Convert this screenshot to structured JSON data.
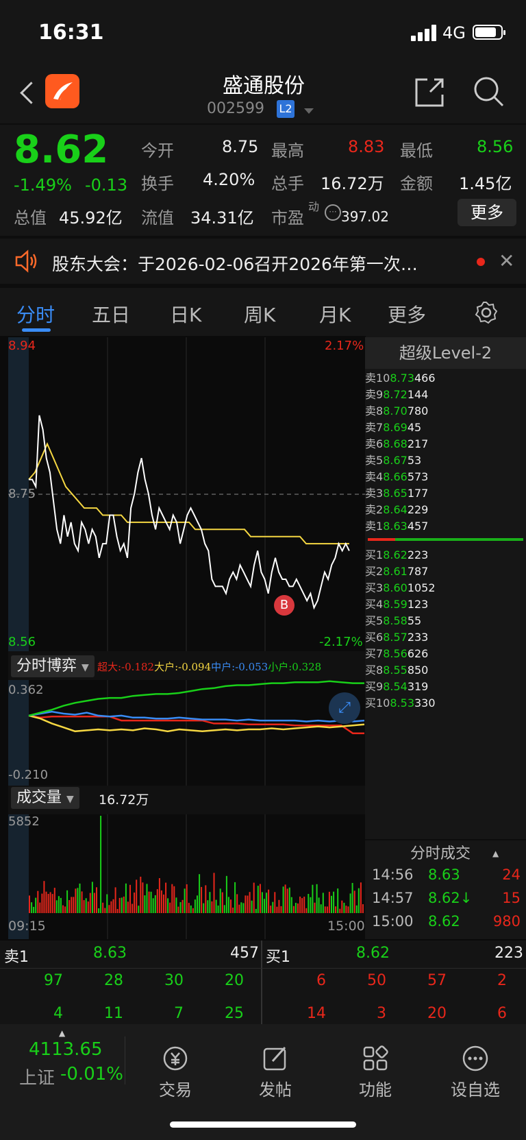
{
  "status_bar": {
    "time": "16:31",
    "network": "4G"
  },
  "header": {
    "title": "盛通股份",
    "code": "002599",
    "badge": "L2"
  },
  "quote": {
    "price": "8.62",
    "change_pct": "-1.49%",
    "change": "-0.13",
    "open_label": "今开",
    "open": "8.75",
    "high_label": "最高",
    "high": "8.83",
    "low_label": "最低",
    "low": "8.56",
    "turnover_label": "换手",
    "turnover": "4.20%",
    "volume_label": "总手",
    "volume": "16.72万",
    "amount_label": "金额",
    "amount": "1.45亿",
    "mcap_label": "总值",
    "mcap": "45.92亿",
    "float_label": "流值",
    "float_mcap": "34.31亿",
    "pe_label": "市盈",
    "pe_sup": "动",
    "pe": "397.02",
    "more_button": "更多"
  },
  "notice": {
    "text": "股东大会：于2026-02-06召开2026年第一次…"
  },
  "tabs": [
    "分时",
    "五日",
    "日K",
    "周K",
    "月K",
    "更多"
  ],
  "chart": {
    "y_max": "8.94",
    "y_max_pct": "2.17%",
    "y_min": "8.56",
    "y_min_pct": "-2.17%",
    "ref_price": "8.75",
    "buy_marker": "B",
    "game_label": "分时博弈",
    "game_legend": [
      {
        "label": "超大:-0.182",
        "color": "#e8271b"
      },
      {
        "label": "大户:-0.094",
        "color": "#f5d742"
      },
      {
        "label": "中户:-0.053",
        "color": "#3a8cf5"
      },
      {
        "label": "小户:0.328",
        "color": "#19d019"
      }
    ],
    "game_max": "0.362",
    "game_min": "-0.210",
    "vol_label": "成交量",
    "vol_total": "16.72万",
    "vol_max": "5852",
    "t_start": "09:15",
    "t_end": "15:00"
  },
  "chart_data": {
    "type": "line",
    "y_range": [
      8.56,
      8.94
    ],
    "price_series": [
      8.75,
      8.75,
      8.74,
      8.84,
      8.82,
      8.78,
      8.76,
      8.72,
      8.68,
      8.66,
      8.7,
      8.67,
      8.69,
      8.66,
      8.65,
      8.69,
      8.68,
      8.66,
      8.68,
      8.67,
      8.64,
      8.66,
      8.66,
      8.7,
      8.7,
      8.67,
      8.65,
      8.66,
      8.64,
      8.71,
      8.73,
      8.76,
      8.78,
      8.75,
      8.73,
      8.7,
      8.68,
      8.71,
      8.7,
      8.69,
      8.68,
      8.7,
      8.69,
      8.66,
      8.68,
      8.7,
      8.71,
      8.7,
      8.69,
      8.68,
      8.66,
      8.65,
      8.61,
      8.6,
      8.6,
      8.6,
      8.59,
      8.61,
      8.62,
      8.61,
      8.63,
      8.62,
      8.61,
      8.6,
      8.63,
      8.65,
      8.62,
      8.61,
      8.59,
      8.62,
      8.64,
      8.62,
      8.61,
      8.61,
      8.6,
      8.6,
      8.61,
      8.6,
      8.59,
      8.58,
      8.59,
      8.57,
      8.58,
      8.6,
      8.62,
      8.61,
      8.63,
      8.64,
      8.66,
      8.65,
      8.66,
      8.65
    ],
    "avg_series": [
      8.75,
      8.76,
      8.78,
      8.8,
      8.78,
      8.76,
      8.74,
      8.73,
      8.72,
      8.71,
      8.71,
      8.71,
      8.7,
      8.7,
      8.7,
      8.7,
      8.69,
      8.69,
      8.69,
      8.69,
      8.69,
      8.69,
      8.69,
      8.69,
      8.69,
      8.69,
      8.69,
      8.68,
      8.68,
      8.68,
      8.68,
      8.68,
      8.68,
      8.68,
      8.68,
      8.68,
      8.67,
      8.67,
      8.67,
      8.67,
      8.67,
      8.67,
      8.67,
      8.67,
      8.67,
      8.66,
      8.66,
      8.66,
      8.66,
      8.66,
      8.66,
      8.66,
      8.66
    ],
    "game_series": [
      {
        "name": "超大",
        "values": [
          0.0,
          -0.02,
          -0.01,
          -0.01,
          -0.01,
          -0.01,
          -0.01,
          -0.01,
          -0.05,
          -0.05,
          -0.05,
          -0.05,
          -0.05,
          -0.05,
          -0.05,
          -0.05,
          -0.08,
          -0.08,
          -0.08,
          -0.09,
          -0.09,
          -0.09,
          -0.09,
          -0.1,
          -0.1,
          -0.1,
          -0.1,
          -0.1,
          -0.18,
          -0.18
        ]
      },
      {
        "name": "大户",
        "values": [
          0.0,
          -0.03,
          -0.08,
          -0.12,
          -0.16,
          -0.15,
          -0.14,
          -0.15,
          -0.14,
          -0.15,
          -0.13,
          -0.14,
          -0.16,
          -0.14,
          -0.15,
          -0.16,
          -0.15,
          -0.14,
          -0.15,
          -0.14,
          -0.14,
          -0.13,
          -0.14,
          -0.13,
          -0.12,
          -0.11,
          -0.12,
          -0.11,
          -0.1,
          -0.09
        ]
      },
      {
        "name": "中户",
        "values": [
          0.0,
          0.02,
          0.04,
          0.02,
          0.01,
          0.03,
          0.0,
          -0.01,
          0.0,
          -0.02,
          -0.02,
          -0.03,
          -0.03,
          -0.02,
          -0.03,
          -0.04,
          -0.04,
          -0.04,
          -0.05,
          -0.04,
          -0.05,
          -0.05,
          -0.05,
          -0.05,
          -0.06,
          -0.05,
          -0.06,
          -0.05,
          -0.06,
          -0.05
        ]
      },
      {
        "name": "小户",
        "values": [
          0.0,
          0.03,
          0.06,
          0.1,
          0.13,
          0.15,
          0.17,
          0.18,
          0.18,
          0.2,
          0.21,
          0.22,
          0.22,
          0.23,
          0.25,
          0.27,
          0.28,
          0.3,
          0.31,
          0.31,
          0.32,
          0.33,
          0.33,
          0.34,
          0.34,
          0.34,
          0.35,
          0.34,
          0.33,
          0.33
        ]
      }
    ],
    "game_range": [
      -0.21,
      0.362
    ],
    "vol_max": 5852
  },
  "order_book": {
    "title": "超级Level-2",
    "asks": [
      {
        "label": "卖10",
        "price": "8.73",
        "vol": "466"
      },
      {
        "label": "卖9",
        "price": "8.72",
        "vol": "144"
      },
      {
        "label": "卖8",
        "price": "8.70",
        "vol": "780"
      },
      {
        "label": "卖7",
        "price": "8.69",
        "vol": "45"
      },
      {
        "label": "卖6",
        "price": "8.68",
        "vol": "217"
      },
      {
        "label": "卖5",
        "price": "8.67",
        "vol": "53"
      },
      {
        "label": "卖4",
        "price": "8.66",
        "vol": "573"
      },
      {
        "label": "卖3",
        "price": "8.65",
        "vol": "177"
      },
      {
        "label": "卖2",
        "price": "8.64",
        "vol": "229"
      },
      {
        "label": "卖1",
        "price": "8.63",
        "vol": "457"
      }
    ],
    "bids": [
      {
        "label": "买1",
        "price": "8.62",
        "vol": "223"
      },
      {
        "label": "买2",
        "price": "8.61",
        "vol": "787"
      },
      {
        "label": "买3",
        "price": "8.60",
        "vol": "1052"
      },
      {
        "label": "买4",
        "price": "8.59",
        "vol": "123"
      },
      {
        "label": "买5",
        "price": "8.58",
        "vol": "55"
      },
      {
        "label": "买6",
        "price": "8.57",
        "vol": "233"
      },
      {
        "label": "买7",
        "price": "8.56",
        "vol": "626"
      },
      {
        "label": "买8",
        "price": "8.55",
        "vol": "850"
      },
      {
        "label": "买9",
        "price": "8.54",
        "vol": "319"
      },
      {
        "label": "买10",
        "price": "8.53",
        "vol": "330"
      }
    ],
    "trades_title": "分时成交",
    "trades": [
      {
        "time": "14:56",
        "price": "8.63",
        "vol": "24"
      },
      {
        "time": "14:57",
        "price": "8.62↓",
        "vol": "15"
      },
      {
        "time": "15:00",
        "price": "8.62",
        "vol": "980"
      }
    ]
  },
  "queue": {
    "sell_label": "卖1",
    "sell_price": "8.63",
    "sell_vol": "457",
    "buy_label": "买1",
    "buy_price": "8.62",
    "buy_vol": "223",
    "sell_row1": [
      "97",
      "28",
      "30",
      "20"
    ],
    "sell_row2": [
      "4",
      "11",
      "7",
      "25"
    ],
    "buy_row1": [
      "6",
      "50",
      "57",
      "2"
    ],
    "buy_row2": [
      "14",
      "3",
      "20",
      "6"
    ]
  },
  "bottom_nav": {
    "index_value": "4113.65",
    "index_name": "上证",
    "index_pct": "-0.01%",
    "items": [
      "交易",
      "发帖",
      "功能",
      "设自选"
    ]
  }
}
